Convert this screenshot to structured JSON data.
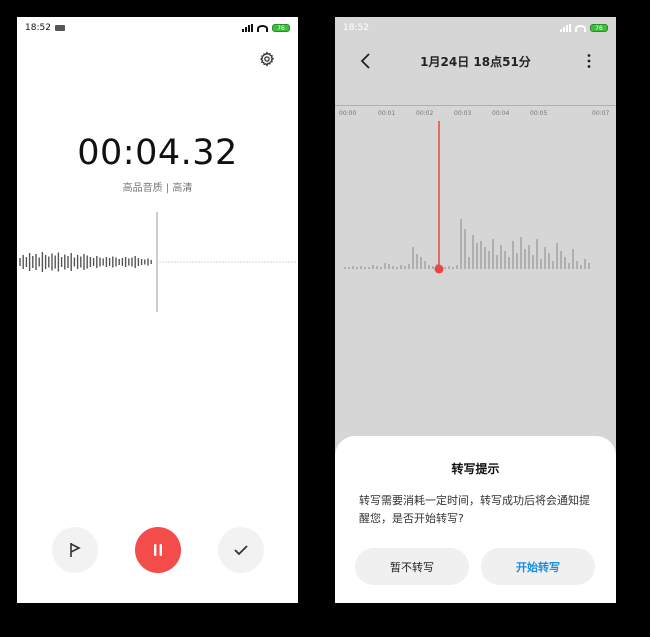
{
  "left": {
    "status": {
      "time": "18:52",
      "battery": "76"
    },
    "timer": "00:04.32",
    "quality": "高品音质 | 高清"
  },
  "right": {
    "status": {
      "time": "18:52",
      "battery": "76"
    },
    "title": "1月24日 18点51分",
    "ticks": [
      "00:00",
      "00:01",
      "00:02",
      "00:03",
      "00:04",
      "00:05",
      "00:07"
    ],
    "dialog": {
      "title": "转写提示",
      "message": "转写需要消耗一定时间，转写成功后将会通知提醒您，是否开始转写?",
      "cancel_label": "暂不转写",
      "confirm_label": "开始转写"
    }
  },
  "colors": {
    "record_red": "#f44b4b",
    "accent_blue": "#1a8fe0",
    "playhead_red": "#e84545"
  },
  "icons": {
    "left_settings": "gear-icon",
    "left_flag": "flag-icon",
    "left_pause": "pause-icon",
    "left_done": "check-icon",
    "right_back": "back-chevron-icon",
    "right_more": "more-vertical-icon"
  }
}
